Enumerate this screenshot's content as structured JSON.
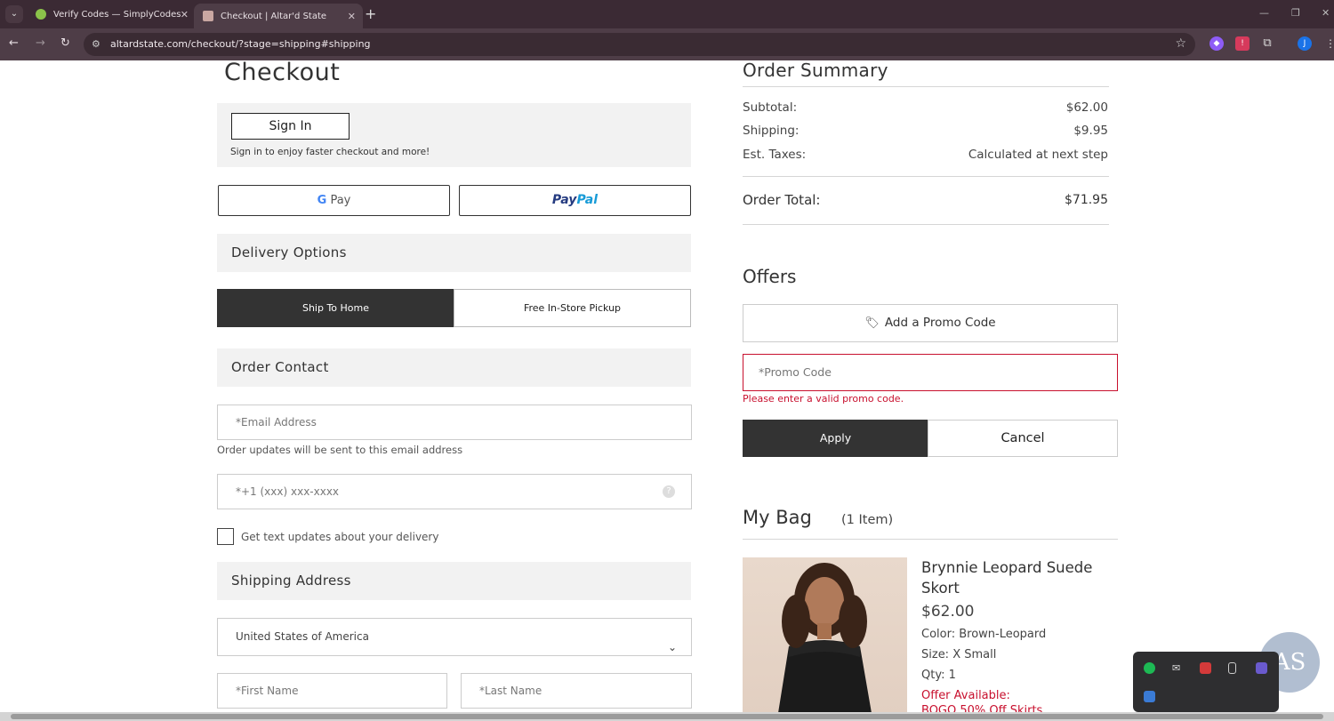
{
  "browser": {
    "tabs": [
      {
        "title": "Verify Codes — SimplyCodes",
        "active": false
      },
      {
        "title": "Checkout | Altar'd State",
        "active": true
      }
    ],
    "url": "altardstate.com/checkout/?stage=shipping#shipping",
    "profile_initial": "J"
  },
  "checkout": {
    "title": "Checkout",
    "sign_in_label": "Sign In",
    "sign_in_note": "Sign in to enjoy faster checkout and more!",
    "gpay_g": "G",
    "gpay_label": "Pay",
    "paypal_p1": "Pay",
    "paypal_p2": "Pal",
    "delivery_options_title": "Delivery Options",
    "delivery_ship_home": "Ship To Home",
    "delivery_pickup": "Free In-Store Pickup",
    "order_contact_title": "Order Contact",
    "email_placeholder": "*Email Address",
    "email_hint": "Order updates will be sent to this email address",
    "phone_placeholder": "*+1  (xxx) xxx-xxxx",
    "text_updates_label": "Get text updates about your delivery",
    "shipping_address_title": "Shipping Address",
    "country_value": "United States of America",
    "first_name_placeholder": "*First Name",
    "last_name_placeholder": "*Last Name"
  },
  "summary": {
    "title": "Order Summary",
    "subtotal_label": "Subtotal:",
    "subtotal_value": "$62.00",
    "shipping_label": "Shipping:",
    "shipping_value": "$9.95",
    "taxes_label": "Est. Taxes:",
    "taxes_value": "Calculated at next step",
    "total_label": "Order Total:",
    "total_value": "$71.95"
  },
  "offers": {
    "title": "Offers",
    "add_promo_label": "Add a Promo Code",
    "promo_placeholder": "*Promo Code",
    "promo_error": "Please enter a valid promo code.",
    "apply_label": "Apply",
    "cancel_label": "Cancel"
  },
  "bag": {
    "title": "My Bag",
    "count": "(1 Item)",
    "item": {
      "name": "Brynnie Leopard Suede Skort",
      "price": "$62.00",
      "color": "Color: Brown-Leopard",
      "size": "Size: X Small",
      "qty": "Qty: 1",
      "offer_label": "Offer Available:",
      "offer_text": "BOGO 50% Off Skirts"
    }
  },
  "brand_badge": "AS",
  "colors": {
    "accent_dark": "#333333",
    "error_red": "#c8102e",
    "section_bg": "#f2f2f2"
  }
}
